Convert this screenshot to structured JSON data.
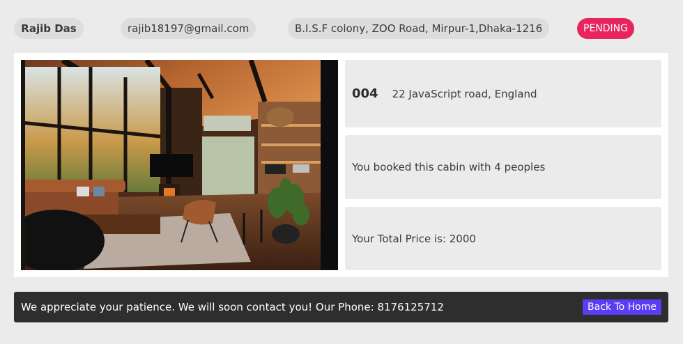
{
  "booking": {
    "name": "Rajib Das",
    "email": "rajib18197@gmail.com",
    "address": "B.I.S.F colony, ZOO Road, Mirpur-1,Dhaka-1216",
    "status": "PENDING"
  },
  "cabin": {
    "number": "004",
    "location": "22 JavaScript road, England",
    "guests_text": "You booked this cabin with 4 peoples",
    "price_text": "Your Total Price is: 2000"
  },
  "footer": {
    "message": "We appreciate your patience. We will soon contact you! Our Phone: 8176125712",
    "back_label": "Back To Home"
  },
  "colors": {
    "status_badge": "#e8245d",
    "back_button": "#5b3df5",
    "footer_bg": "#2e2e2e"
  }
}
